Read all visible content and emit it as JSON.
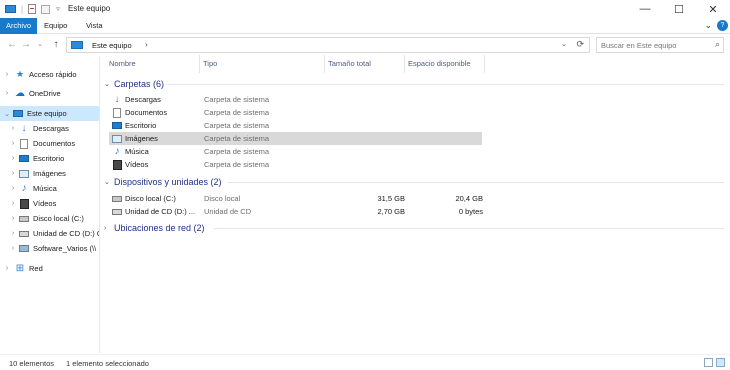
{
  "window": {
    "title": "Este equipo",
    "controls": {
      "minimize": "—",
      "maximize": "☐",
      "close": "✕"
    }
  },
  "ribbon": {
    "tabs": [
      "Archivo",
      "Equipo",
      "Vista"
    ],
    "expand": "⌄",
    "help": "?"
  },
  "addressbar": {
    "back": "←",
    "forward": "→",
    "recent": "⌄",
    "up": "↑",
    "path": "Este equipo",
    "separator": "›",
    "dropdown": "⌄",
    "refresh": "⟳"
  },
  "search": {
    "placeholder": "Buscar en Este equipo",
    "icon": "⌕"
  },
  "sidebar": {
    "items": [
      {
        "label": "Acceso rápido",
        "icon": "star-icon"
      },
      {
        "label": "OneDrive",
        "icon": "cloud-icon"
      },
      {
        "label": "Este equipo",
        "icon": "computer-icon",
        "selected": true
      },
      {
        "label": "Descargas",
        "icon": "download-icon"
      },
      {
        "label": "Documentos",
        "icon": "document-icon"
      },
      {
        "label": "Escritorio",
        "icon": "desktop-icon"
      },
      {
        "label": "Imágenes",
        "icon": "picture-icon"
      },
      {
        "label": "Música",
        "icon": "music-icon"
      },
      {
        "label": "Vídeos",
        "icon": "video-icon"
      },
      {
        "label": "Disco local (C:)",
        "icon": "disk-icon"
      },
      {
        "label": "Unidad de CD (D:) G",
        "icon": "cd-drive-icon"
      },
      {
        "label": "Software_Varios (\\\\",
        "icon": "network-drive-icon"
      },
      {
        "label": "Red",
        "icon": "network-icon"
      }
    ]
  },
  "columns": {
    "name": "Nombre",
    "type": "Tipo",
    "total": "Tamaño total",
    "free": "Espacio disponible"
  },
  "groups": {
    "folders": {
      "title": "Carpetas (6)",
      "items": [
        {
          "name": "Descargas",
          "type": "Carpeta de sistema",
          "icon": "download-icon"
        },
        {
          "name": "Documentos",
          "type": "Carpeta de sistema",
          "icon": "document-icon"
        },
        {
          "name": "Escritorio",
          "type": "Carpeta de sistema",
          "icon": "desktop-icon"
        },
        {
          "name": "Imágenes",
          "type": "Carpeta de sistema",
          "icon": "picture-icon",
          "selected": true
        },
        {
          "name": "Música",
          "type": "Carpeta de sistema",
          "icon": "music-icon"
        },
        {
          "name": "Vídeos",
          "type": "Carpeta de sistema",
          "icon": "video-icon"
        }
      ]
    },
    "devices": {
      "title": "Dispositivos y unidades (2)",
      "items": [
        {
          "name": "Disco local (C:)",
          "type": "Disco local",
          "total": "31,5 GB",
          "free": "20,4 GB",
          "icon": "disk-icon"
        },
        {
          "name": "Unidad de CD (D:) ...",
          "type": "Unidad de CD",
          "total": "2,70 GB",
          "free": "0 bytes",
          "icon": "cd-drive-icon"
        }
      ]
    },
    "network": {
      "title": "Ubicaciones de red (2)"
    }
  },
  "status": {
    "count": "10 elementos",
    "selection": "1 elemento seleccionado"
  },
  "colors": {
    "accent": "#1979ca",
    "selection": "#cce8ff",
    "group_header": "#1e3287"
  }
}
